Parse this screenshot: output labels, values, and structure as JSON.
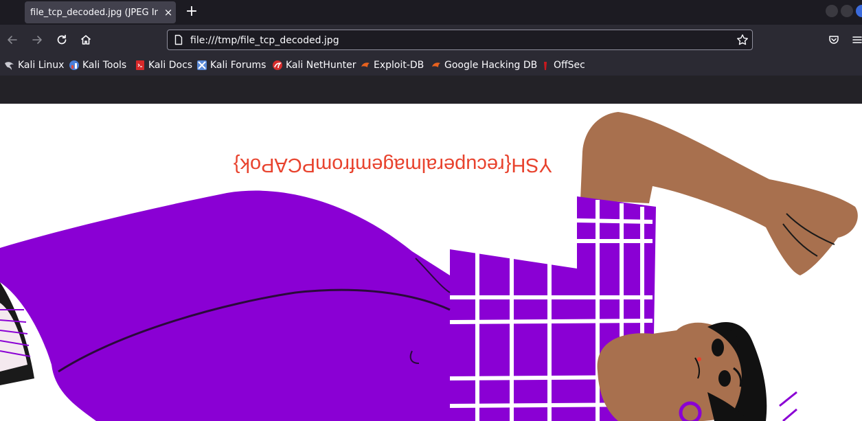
{
  "tab": {
    "title": "file_tcp_decoded.jpg (JPEG Im",
    "close_label": "×"
  },
  "new_tab_label": "+",
  "nav": {
    "url": "file:///tmp/file_tcp_decoded.jpg"
  },
  "bookmarks": [
    {
      "label": "Kali Linux",
      "icon": "kali-dragon-icon"
    },
    {
      "label": "Kali Tools",
      "icon": "kali-tools-icon"
    },
    {
      "label": "Kali Docs",
      "icon": "kali-docs-icon"
    },
    {
      "label": "Kali Forums",
      "icon": "kali-forums-icon"
    },
    {
      "label": "Kali NetHunter",
      "icon": "nethunter-icon"
    },
    {
      "label": "Exploit-DB",
      "icon": "exploit-db-icon"
    },
    {
      "label": "Google Hacking DB",
      "icon": "ghdb-icon"
    },
    {
      "label": "OffSec",
      "icon": "offsec-icon"
    }
  ],
  "image": {
    "flag_text": "YSH{recuperalmagemfromPCAPok}",
    "orientation": "upside-down",
    "colors": {
      "purple": "#8a00d4",
      "skin": "#a8704e",
      "flag_red": "#e8432e",
      "hair": "#111111"
    }
  },
  "theme": {
    "tabstrip_bg": "#1c1b22",
    "toolbar_bg": "#2b2a33",
    "accent_blue": "#3b6bdc"
  }
}
